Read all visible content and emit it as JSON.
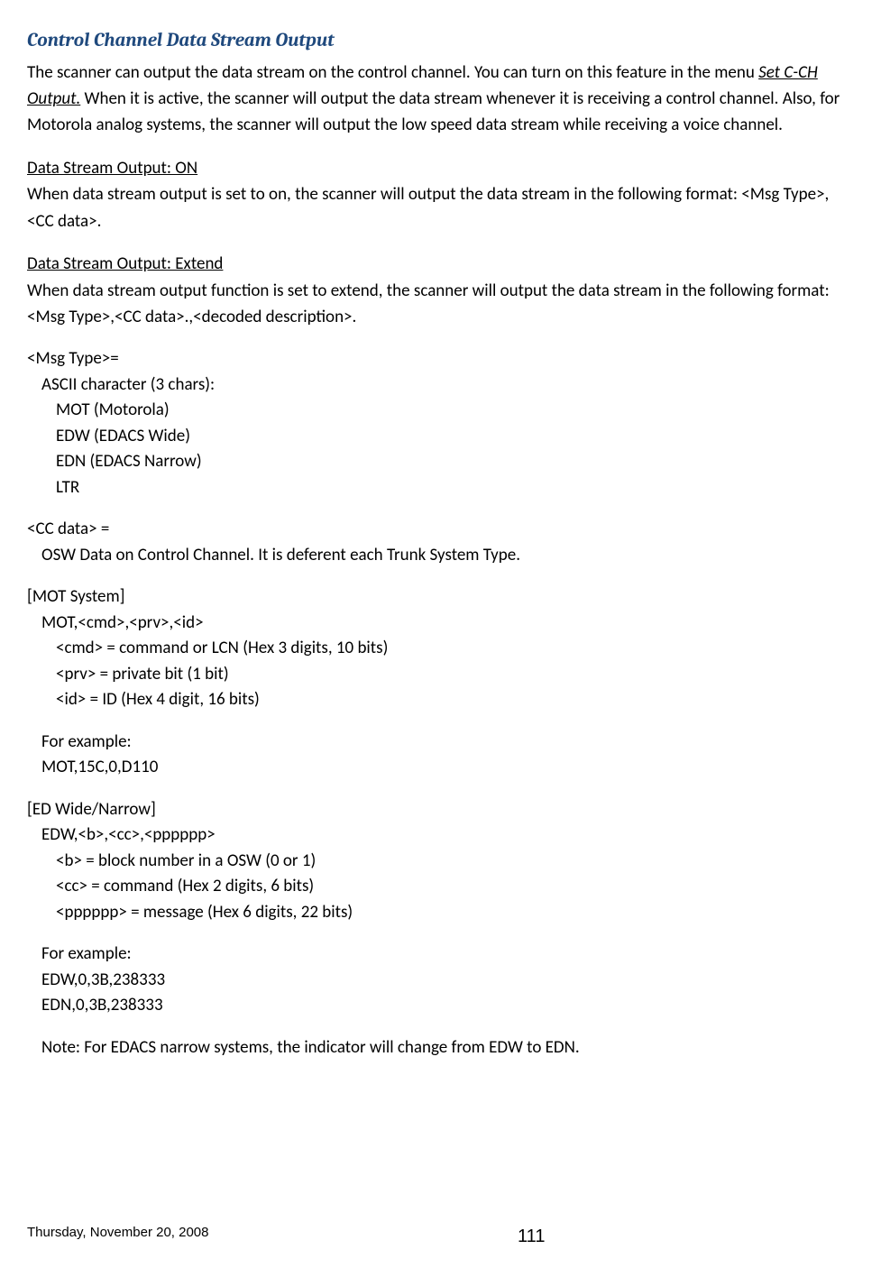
{
  "heading": "Control Channel Data Stream Output",
  "intro": {
    "pre": "The scanner can output the data stream on the control channel. You can turn on this feature in the menu ",
    "menu": "Set C-CH Output.",
    "post": " When it is active, the scanner will output the data stream whenever it is receiving a control channel. Also, for Motorola analog systems, the scanner will output the low speed data stream while receiving a voice channel."
  },
  "on": {
    "title": " Data Stream Output: ON",
    "body": " When data stream output is set to on, the scanner will output the data stream in the following format: <Msg Type>,<CC data>."
  },
  "extend": {
    "title": "Data Stream Output: Extend",
    "body": "When data stream output function is set to extend, the scanner will output the data stream in the following format: <Msg Type>,<CC data>.,<decoded description>."
  },
  "msgtype": {
    "l1": "<Msg Type>=",
    "l2": "ASCII character (3 chars):",
    "l3": "MOT (Motorola)",
    "l4": "EDW (EDACS Wide)",
    "l5": "EDN (EDACS Narrow)",
    "l6": "LTR"
  },
  "ccdata": {
    "l1": "<CC data> =",
    "l2": "OSW Data on Control Channel. It is deferent each Trunk System Type."
  },
  "mot": {
    "l1": "[MOT System]",
    "l2": "MOT,<cmd>,<prv>,<id>",
    "l3": "<cmd> = command or LCN (Hex 3 digits, 10 bits)",
    "l4": "<prv> = private bit (1 bit)",
    "l5": "<id> = ID (Hex 4 digit, 16 bits)",
    "ex_label": "For example:",
    "ex": "MOT,15C,0,D110"
  },
  "ed": {
    "l1": "[ED Wide/Narrow]",
    "l2": "EDW,<b>,<cc>,<pppppp>",
    "l3": "<b> = block number in a OSW (0 or 1)",
    "l4": "<cc> = command (Hex 2 digits, 6 bits)",
    "l5": "<pppppp> = message (Hex 6 digits, 22 bits)",
    "ex_label": "For example:",
    "ex1": "EDW,0,3B,238333",
    "ex2": "EDN,0,3B,238333",
    "note": "Note: For EDACS narrow systems, the indicator will change from EDW to EDN."
  },
  "footer": {
    "date": "Thursday, November 20, 2008",
    "page": "111"
  }
}
